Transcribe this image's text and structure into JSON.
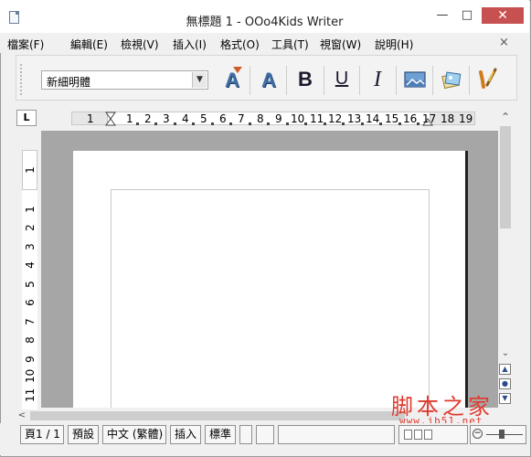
{
  "window": {
    "title": "無標題 1 - OOo4Kids Writer",
    "minimize_label": "—",
    "maximize_label": "□",
    "close_label": "✕"
  },
  "menu": {
    "items": [
      {
        "label": "檔案(F)"
      },
      {
        "label": "編輯(E)"
      },
      {
        "label": "檢視(V)"
      },
      {
        "label": "插入(I)"
      },
      {
        "label": "格式(O)"
      },
      {
        "label": "工具(T)"
      },
      {
        "label": "視窗(W)"
      },
      {
        "label": "說明(H)"
      }
    ],
    "close_doc_label": "×"
  },
  "toolbar": {
    "font_name": "新細明體",
    "bold_label": "B",
    "underline_label": "U",
    "italic_label": "I",
    "fontwork_label": "A",
    "buttons": [
      {
        "name": "fontwork-gallery",
        "icon": "fontwork-a-icon"
      },
      {
        "name": "fontwork-style",
        "icon": "fontwork-a-icon"
      },
      {
        "name": "bold",
        "icon": "bold-icon"
      },
      {
        "name": "underline",
        "icon": "underline-icon"
      },
      {
        "name": "italic",
        "icon": "italic-icon"
      },
      {
        "name": "insert-image",
        "icon": "picture-icon"
      },
      {
        "name": "gallery",
        "icon": "gallery-icon"
      },
      {
        "name": "highlight",
        "icon": "paintbrush-icon"
      }
    ]
  },
  "ruler": {
    "tab_type_label": "L",
    "horizontal_numbers": [
      "1",
      "1",
      "2",
      "3",
      "4",
      "5",
      "6",
      "7",
      "8",
      "9",
      "10",
      "11",
      "12",
      "13",
      "14",
      "15",
      "16",
      "17",
      "18",
      "19"
    ],
    "vertical_top_number": "1",
    "vertical_numbers": [
      "1",
      "2",
      "3",
      "4",
      "5",
      "6",
      "7",
      "8",
      "9",
      "10",
      "11"
    ]
  },
  "scrollbars": {
    "up_arrow": "⌃",
    "down_arrow": "⌄",
    "left_arrow": "<",
    "nav_prev": "▲",
    "nav_mid": "●",
    "nav_next": "▼"
  },
  "watermark": {
    "text": "脚本之家",
    "url": "www.jb51.net"
  },
  "status": {
    "page": "頁1 / 1",
    "style": "預設",
    "language": "中文 (繁體)",
    "insert_mode": "插入",
    "selection_mode": "標準",
    "empty1": "",
    "empty2": "",
    "empty3": ""
  },
  "colors": {
    "close_button": "#c75050",
    "document_background": "#a6a6a6",
    "page": "#ffffff",
    "watermark": "#e03a2e",
    "fontwork": "#3f6fa6"
  }
}
